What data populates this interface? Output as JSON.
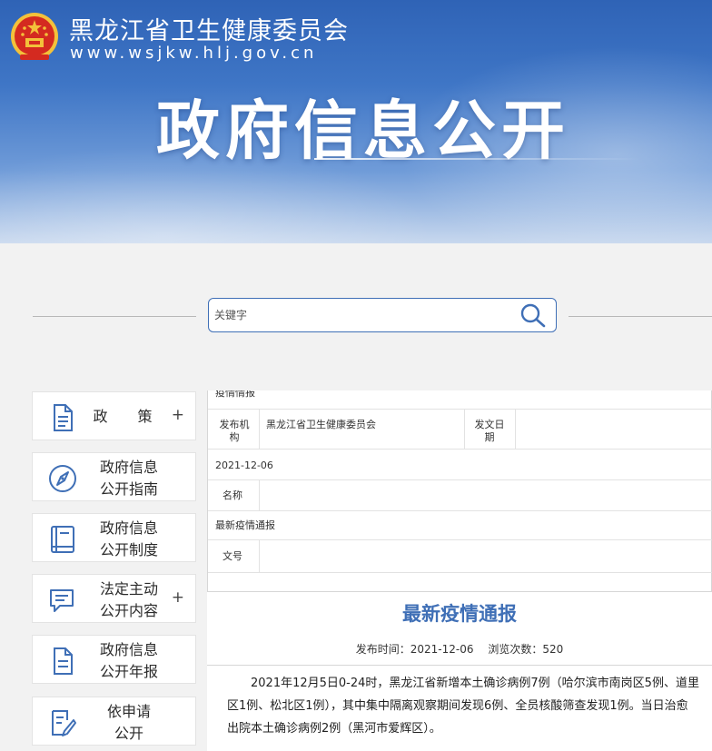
{
  "header": {
    "site_name": "黑龙江省卫生健康委员会",
    "site_url": "www.wsjkw.hlj.gov.cn",
    "section_title": "政府信息公开"
  },
  "search": {
    "placeholder": "关键字"
  },
  "sidebar": {
    "items": [
      {
        "label": "政 策",
        "has_plus": true,
        "plus": "+",
        "icon": "document-icon"
      },
      {
        "label_line1": "政府信息",
        "label_line2": "公开指南",
        "icon": "compass-icon"
      },
      {
        "label_line1": "政府信息",
        "label_line2": "公开制度",
        "icon": "book-icon"
      },
      {
        "label_line1": "法定主动",
        "label_line2": "公开内容",
        "has_plus": true,
        "plus": "+",
        "icon": "chat-icon"
      },
      {
        "label_line1": "政府信息",
        "label_line2": "公开年报",
        "icon": "report-icon"
      },
      {
        "label_line1": "依申请",
        "label_line2": "公开",
        "icon": "edit-icon"
      }
    ]
  },
  "meta": {
    "cut_off_text": "疫情情报",
    "issuer_label_1": "发布机",
    "issuer_label_2": "构",
    "issuer_value": "黑龙江省卫生健康委员会",
    "date_label_1": "发文日",
    "date_label_2": "期",
    "date_value": "2021-12-06",
    "name_label": "名称",
    "name_value": "最新疫情通报",
    "doc_no_label": "文号"
  },
  "article": {
    "title": "最新疫情通报",
    "publish_time_label": "发布时间：",
    "publish_time": "2021-12-06",
    "views_label": "浏览次数：",
    "views": "520",
    "body": "2021年12月5日0-24时，黑龙江省新增本土确诊病例7例（哈尔滨市南岗区5例、道里区1例、松北区1例），其中集中隔离观察期间发现6例、全员核酸筛查发现1例。当日治愈出院本土确诊病例2例（黑河市爱辉区）。"
  },
  "colors": {
    "brand_blue": "#3f6fb6",
    "banner_top": "#2f63b6",
    "emblem_red": "#d42a20",
    "emblem_gold": "#f3c13a"
  }
}
